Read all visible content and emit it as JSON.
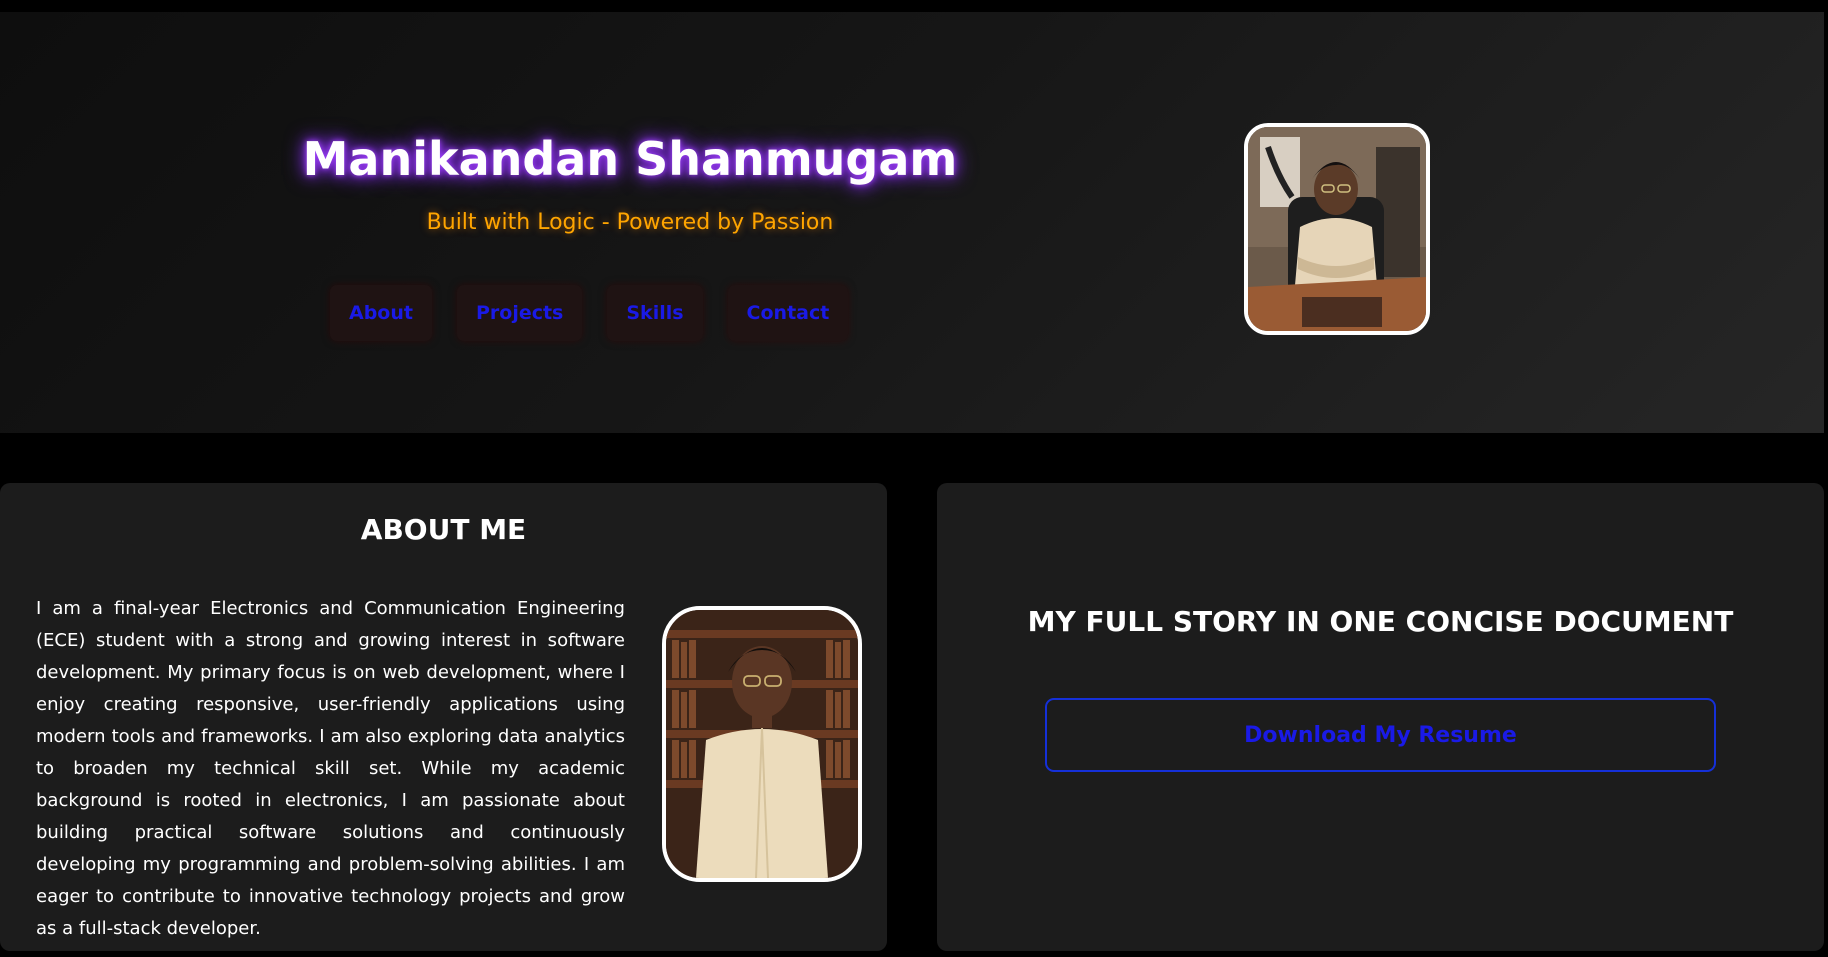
{
  "header": {
    "name": "Manikandan Shanmugam",
    "tagline": "Built with Logic - Powered by Passion",
    "nav": [
      {
        "label": "About"
      },
      {
        "label": "Projects"
      },
      {
        "label": "Skills"
      },
      {
        "label": "Contact"
      }
    ],
    "profile_photo": "profile-photo-seated-office"
  },
  "about": {
    "title": "ABOUT ME",
    "text": "I am a final-year Electronics and Communication Engineering (ECE) student with a strong and growing interest in software development. My primary focus is on web development, where I enjoy creating responsive, user-friendly applications using modern tools and frameworks. I am also exploring data analytics to broaden my technical skill set. While my academic background is rooted in electronics, I am passionate about building practical software solutions and continuously developing my programming and problem-solving abilities. I am eager to contribute to innovative technology projects and grow as a full-stack developer.",
    "photo": "portrait-photo-library"
  },
  "resume": {
    "title": "MY FULL STORY IN ONE CONCISE DOCUMENT",
    "button_label": "Download My Resume"
  },
  "colors": {
    "page_bg": "#000000",
    "card_bg": "#1c1c1c",
    "title_glow": "#8a2be2",
    "tagline": "#ffa500",
    "link_blue": "#1a1ae6",
    "nav_button_bg": "#1f1313"
  }
}
